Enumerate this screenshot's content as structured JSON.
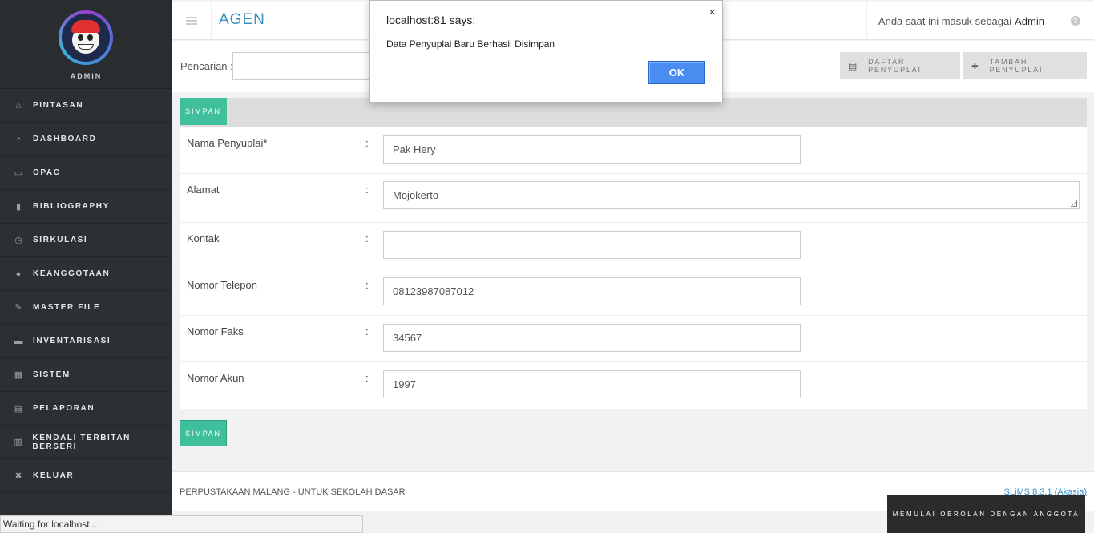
{
  "sidebar": {
    "role": "ADMIN",
    "items": [
      {
        "label": "PINTASAN",
        "icon": "home-icon",
        "glyph": "⌂"
      },
      {
        "label": "DASHBOARD",
        "icon": "dashboard-icon",
        "glyph": "◔"
      },
      {
        "label": "OPAC",
        "icon": "desktop-icon",
        "glyph": "▭"
      },
      {
        "label": "BIBLIOGRAPHY",
        "icon": "bookmark-icon",
        "glyph": "▮"
      },
      {
        "label": "SIRKULASI",
        "icon": "clock-icon",
        "glyph": "◷"
      },
      {
        "label": "KEANGGOTAAN",
        "icon": "user-icon",
        "glyph": "●"
      },
      {
        "label": "MASTER FILE",
        "icon": "pencil-icon",
        "glyph": "✎"
      },
      {
        "label": "INVENTARISASI",
        "icon": "briefcase-icon",
        "glyph": "▬"
      },
      {
        "label": "SISTEM",
        "icon": "keyboard-icon",
        "glyph": "▦"
      },
      {
        "label": "PELAPORAN",
        "icon": "file-icon",
        "glyph": "▤"
      },
      {
        "label": "KENDALI TERBITAN BERSERI",
        "icon": "film-icon",
        "glyph": "▥"
      },
      {
        "label": "KELUAR",
        "icon": "close-icon",
        "glyph": "✖"
      }
    ]
  },
  "header": {
    "title": "AGEN",
    "user_prefix": "Anda saat ini masuk sebagai",
    "user_name": "Admin",
    "help_glyph": "?"
  },
  "search": {
    "label": "Pencarian :",
    "value": ""
  },
  "actions": {
    "list_label": "DAFTAR PENYUPLAI",
    "add_label": "TAMBAH PENYUPLAI",
    "list_glyph": "▤",
    "add_glyph": "+"
  },
  "form": {
    "save_label": "SIMPAN",
    "colon": ":",
    "fields": [
      {
        "label": "Nama Penyuplai*",
        "value": "Pak Hery"
      },
      {
        "label": "Alamat",
        "value": "Mojokerto"
      },
      {
        "label": "Kontak",
        "value": ""
      },
      {
        "label": "Nomor Telepon",
        "value": "08123987087012"
      },
      {
        "label": "Nomor Faks",
        "value": "34567"
      },
      {
        "label": "Nomor Akun",
        "value": "1997"
      }
    ]
  },
  "footer": {
    "text": "PERPUSTAKAAN MALANG - UNTUK SEKOLAH DASAR",
    "version": "SLiMS 8.3.1 (Akasia)"
  },
  "chat": {
    "label": "MEMULAI OBROLAN DENGAN ANGGOTA"
  },
  "status": {
    "text": "Waiting for localhost..."
  },
  "dialog": {
    "title": "localhost:81 says:",
    "message": "Data Penyuplai Baru Berhasil Disimpan",
    "ok_label": "OK",
    "close_glyph": "×"
  },
  "colors": {
    "accent": "#3a8fc4",
    "save_green": "#3fbf9b",
    "sidebar_bg": "#2c2f33",
    "dialog_ok": "#4a8df0"
  }
}
